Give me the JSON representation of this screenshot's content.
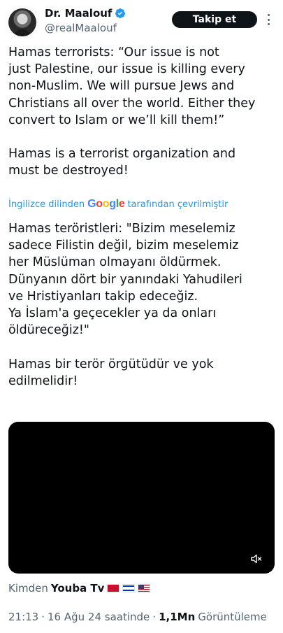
{
  "author": {
    "display_name": "Dr. Maalouf",
    "handle": "@realMaalouf",
    "verified": true,
    "verified_color": "#1d9bf0"
  },
  "actions": {
    "follow_label": "Takip et",
    "more_icon": "more-vertical-icon"
  },
  "tweet": {
    "original_text": "Hamas terrorists: “Our issue is not\njust Palestine, our issue is killing every\nnon-Muslim. We will pursue Jews and\nChristians all over the world. Either they\nconvert to Islam or we’ll kill them!”\n\nHamas is a terrorist organization and\nmust be destroyed!",
    "translation_prefix": "İngilizce dilinden",
    "translation_provider": "Google",
    "translation_suffix": "tarafından çevrilmiştir",
    "translated_text": "Hamas teröristleri: \"Bizim meselemiz\nsadece Filistin değil, bizim meselemiz\nher Müslüman olmayanı öldürmek.\nDünyanın dört bir yanındaki Yahudileri\nve Hristiyanları takip edeceğiz.\nYa İslam'a geçecekler ya da onları\nöldüreceğiz!\"\n\nHamas bir terör örgütüdür ve yok\nedilmelidir!"
  },
  "media": {
    "type": "video",
    "mute_icon": "speaker-muted-icon"
  },
  "source": {
    "prefix": "Kimden",
    "name": "Youba Tv"
  },
  "meta": {
    "time": "21:13",
    "separator": "·",
    "date": "16 Ağu 24 saatinde",
    "views_count": "1,1Mn",
    "views_label": "Görüntüleme"
  },
  "colors": {
    "accent": "#1d9bf0",
    "text_primary": "#0f1419",
    "text_secondary": "#536471"
  }
}
